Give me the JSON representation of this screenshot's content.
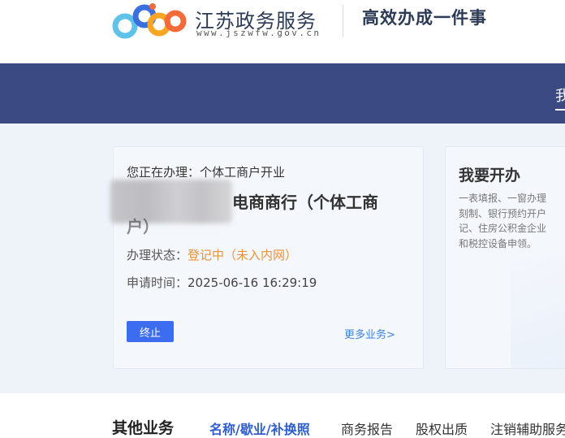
{
  "header": {
    "site_name": "江苏政务服务",
    "site_url": "www.jszwfw.gov.cn",
    "slogan": "高效办成一件事",
    "logo_colors": [
      "#f26b3a",
      "#f6a623",
      "#3a6fe0",
      "#5fc2e8"
    ]
  },
  "nav": {
    "item_label": "我"
  },
  "application": {
    "processing_label": "您正在办理：个体工商户开业",
    "business_name_visible": "电商商行（个体工商",
    "business_name_line2": "户）",
    "status_label": "办理状态：",
    "status_value": "登记中（未入内网）",
    "time_label": "申请时间：",
    "time_value": "2025-06-16 16:29:19",
    "stop_button": "终止",
    "more_link": "更多业务>"
  },
  "open_card": {
    "title": "我要开办",
    "desc_lines": [
      "一表填报、一窗办理",
      "刻制、银行预约开户",
      "记、住房公积金企业",
      "和税控设备申领。"
    ]
  },
  "other": {
    "title": "其他业务",
    "tabs": [
      "名称/歇业/补换照",
      "商务报告",
      "股权出质",
      "注销辅助服务"
    ]
  },
  "colors": {
    "nav_bg": "#3b4a82",
    "accent_blue": "#3c6df0",
    "status_orange": "#e8923a",
    "tab_active": "#2f5fd0"
  }
}
